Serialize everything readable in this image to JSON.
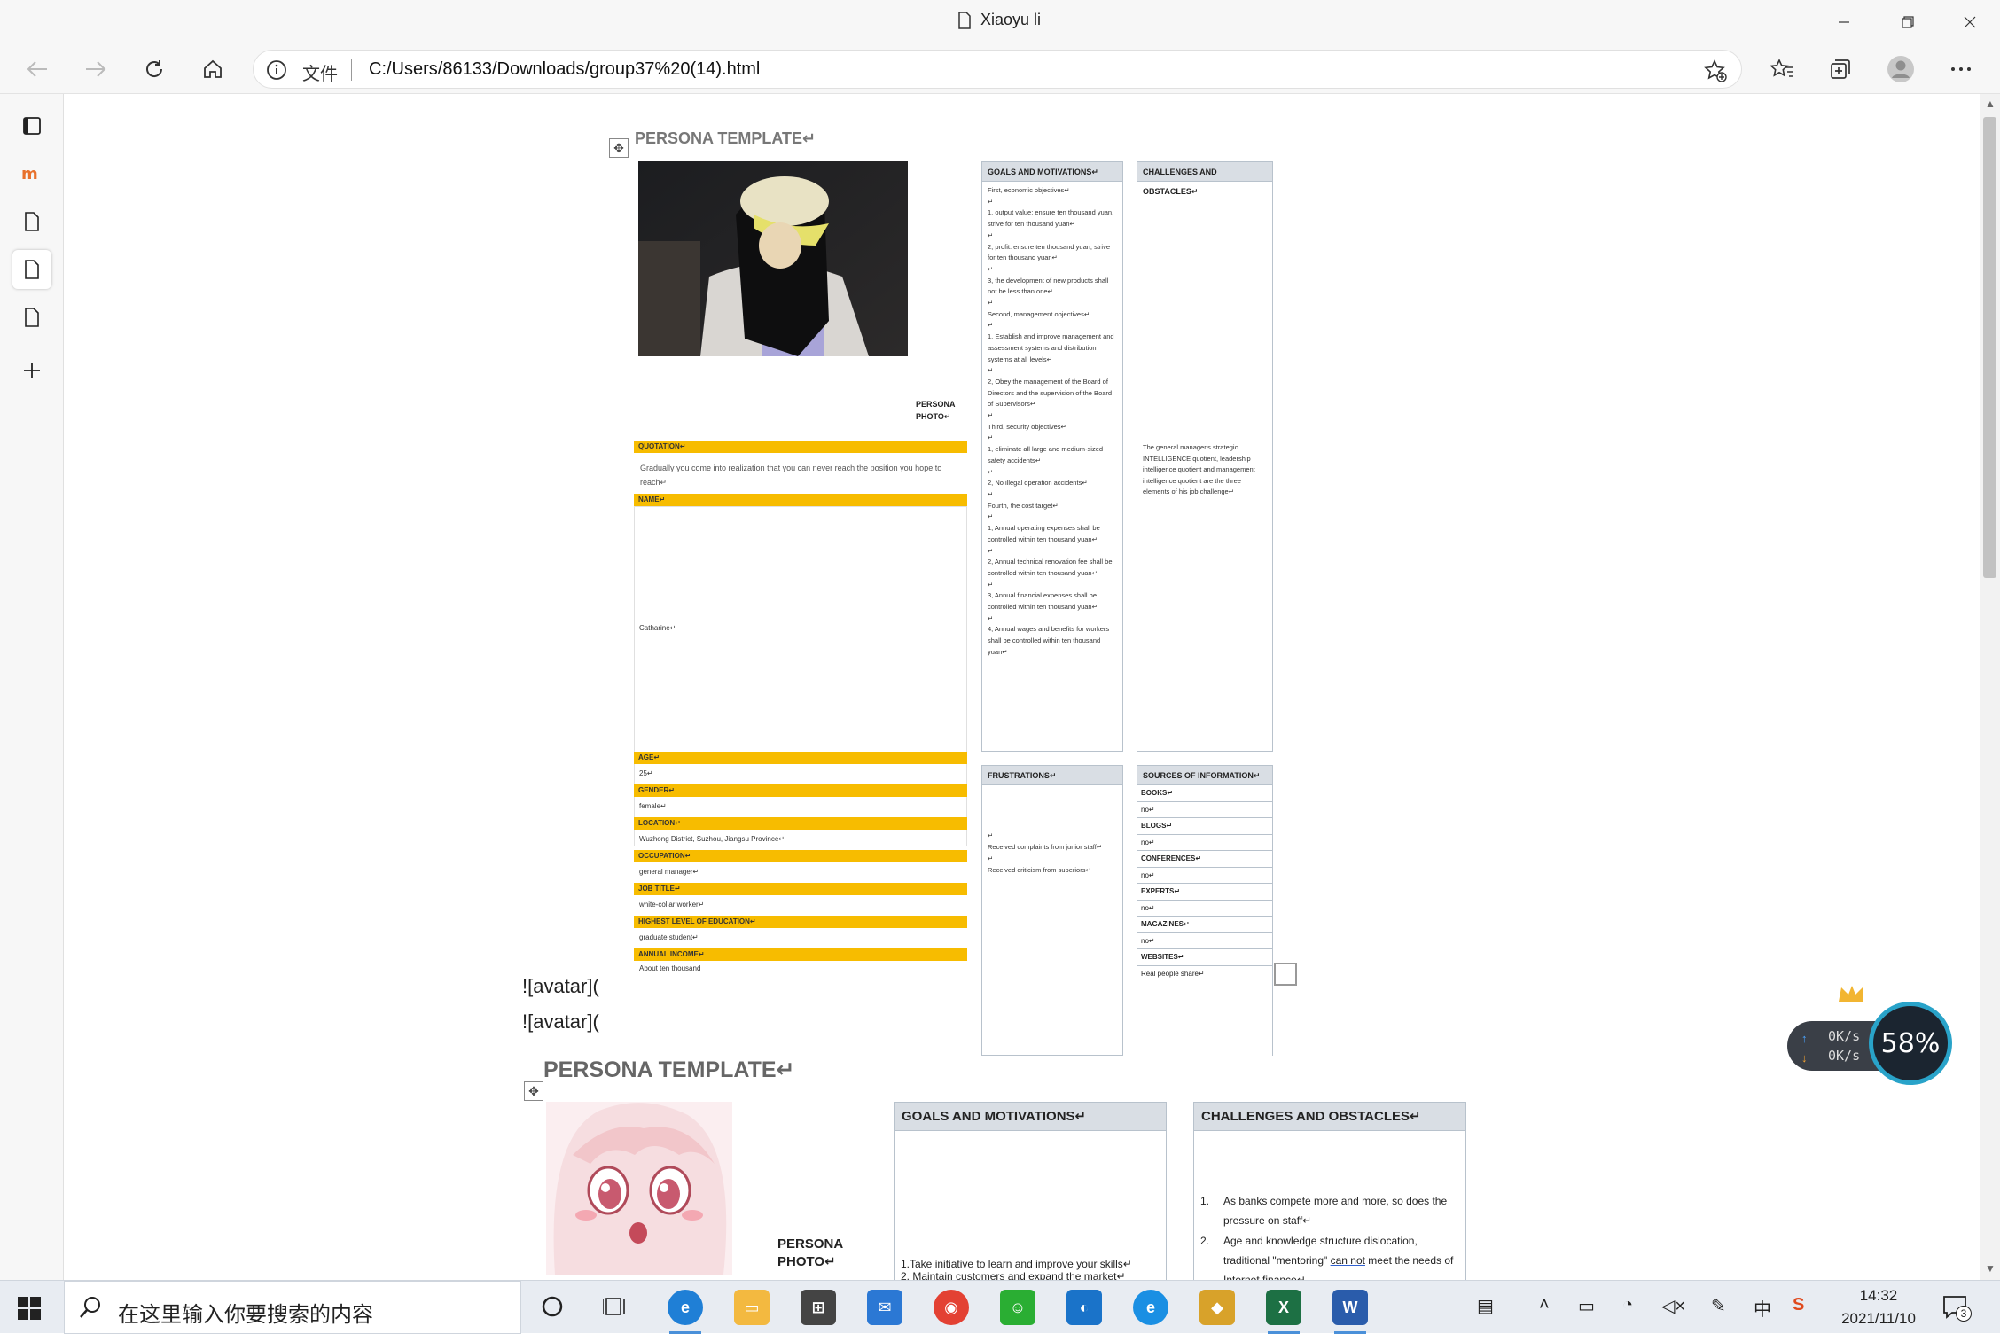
{
  "window": {
    "title": "Xiaoyu li"
  },
  "toolbar": {
    "scheme_label": "文件",
    "url": "C:/Users/86133/Downloads/group37%20(14).html"
  },
  "persona1": {
    "heading": "PERSONA TEMPLATE↵",
    "photo_label": "PERSONA\nPHOTO↵",
    "quotation_label": "QUOTATION↵",
    "quotation": "Gradually you come into realization that you can never reach the position you hope to reach↵",
    "name_label": "NAME↵",
    "name": "Catharine↵",
    "age_label": "AGE↵",
    "age": "25↵",
    "gender_label": "GENDER↵",
    "gender": "female↵",
    "location_label": "LOCATION↵",
    "location": "Wuzhong District, Suzhou, Jiangsu Province↵",
    "occupation_label": "OCCUPATION↵",
    "occupation": "general manager↵",
    "job_title_label": "JOB TITLE↵",
    "job_title": "white-collar worker↵",
    "education_label": "HIGHEST LEVEL OF EDUCATION↵",
    "education": "graduate student↵",
    "income_label": "ANNUAL INCOME↵",
    "income": "About ten thousand",
    "goals_label": "GOALS AND MOTIVATIONS↵",
    "goals": "First, economic objectives↵\n↵\n1, output value: ensure ten thousand yuan, strive for ten thousand yuan↵\n↵\n2, profit: ensure ten thousand yuan, strive for ten thousand yuan↵\n↵\n3, the development of new products shall not be less than one↵\n↵\nSecond, management objectives↵\n↵\n1, Establish and improve management and assessment systems and distribution systems at all levels↵\n↵\n2, Obey the management of the Board of Directors and the supervision of the Board of Supervisors↵\n↵\nThird, security objectives↵\n↵\n1, eliminate all large and medium-sized safety accidents↵\n↵\n2, No illegal operation accidents↵\n↵\nFourth, the cost target↵\n↵\n1, Annual operating expenses shall be controlled within ten thousand yuan↵\n↵\n2, Annual technical renovation fee shall be controlled within ten thousand yuan↵\n↵\n3, Annual financial expenses shall be controlled within ten thousand yuan↵\n↵\n4, Annual wages and benefits for workers shall be controlled within ten thousand yuan↵",
    "challenges_label": "CHALLENGES AND OBSTACLES↵",
    "challenges": "The general manager's strategic INTELLIGENCE quotient, leadership intelligence quotient and management intelligence quotient are the three elements of his job challenge↵",
    "frustrations_label": "FRUSTRATIONS↵",
    "frustrations": "↵\nReceived complaints from junior staff↵\n↵\nReceived criticism from superiors↵",
    "sources_label": "SOURCES OF INFORMATION↵",
    "sources": [
      {
        "label": "BOOKS↵",
        "value": "no↵"
      },
      {
        "label": "BLOGS↵",
        "value": "no↵"
      },
      {
        "label": "CONFERENCES↵",
        "value": "no↵"
      },
      {
        "label": "EXPERTS↵",
        "value": "no↵"
      },
      {
        "label": "MAGAZINES↵",
        "value": "no↵"
      },
      {
        "label": "WEBSITES↵",
        "value": "Real people share↵"
      }
    ]
  },
  "markdown_lines": [
    "![avatar](",
    "![avatar]("
  ],
  "persona2": {
    "heading": "PERSONA TEMPLATE↵",
    "photo_label": "PERSONA\nPHOTO↵",
    "goals_label": "GOALS AND MOTIVATIONS↵",
    "goals_1": "1.Take initiative to learn and improve your skills↵",
    "goals_2": "2. Maintain customers and expand the market↵",
    "challenges_label": "CHALLENGES AND OBSTACLES↵",
    "challenge_1": "As banks compete more and more, so does the pressure on staff↵",
    "challenge_2a": "Age and knowledge structure dislocation, traditional \"mentoring\" ",
    "challenge_2b": "can not",
    "challenge_2c": " meet the needs of Internet finance↵"
  },
  "net_widget": {
    "up": "0K/s",
    "down": "0K/s",
    "percent": "58%"
  },
  "taskbar": {
    "search_placeholder": "在这里输入你要搜索的内容",
    "ime": "中",
    "time": "14:32",
    "date": "2021/11/10",
    "notif_count": "3"
  }
}
